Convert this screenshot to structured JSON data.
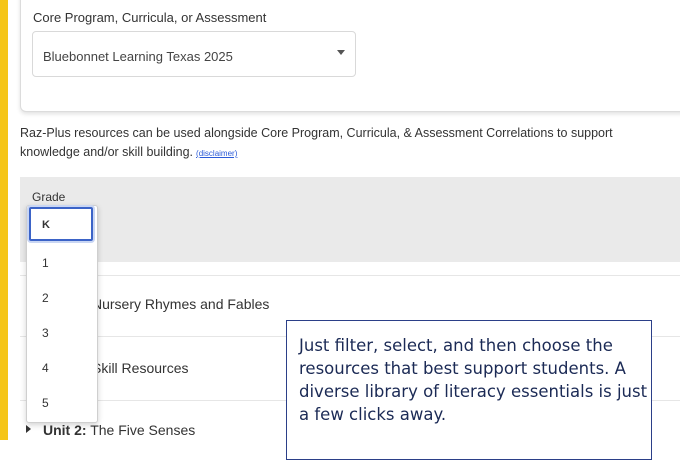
{
  "filter": {
    "label": "Core Program, Curricula, or Assessment",
    "selected": "Bluebonnet Learning Texas 2025"
  },
  "description": {
    "line1": "Raz-Plus resources can be used alongside Core Program, Curricula, & Assessment Correlations to support",
    "line2": "knowledge and/or skill building.",
    "disclaimer": "(disclaimer)"
  },
  "grade": {
    "label": "Grade",
    "options": [
      "K",
      "1",
      "2",
      "3",
      "4",
      "5"
    ],
    "selected": "K"
  },
  "rows": [
    {
      "text": "Nursery Rhymes and Fables"
    },
    {
      "text": "Skill Resources"
    },
    {
      "bold": "Unit 2:",
      "text": " The Five Senses"
    }
  ],
  "callout": {
    "text": "Just filter, select, and then choose the resources that best support students. A diverse library of literacy essentials is just a few clicks away."
  },
  "colors": {
    "accent": "#f5c518",
    "link": "#2a5ad8",
    "selected_border": "#3b63c7",
    "callout_text": "#1b2a55"
  }
}
